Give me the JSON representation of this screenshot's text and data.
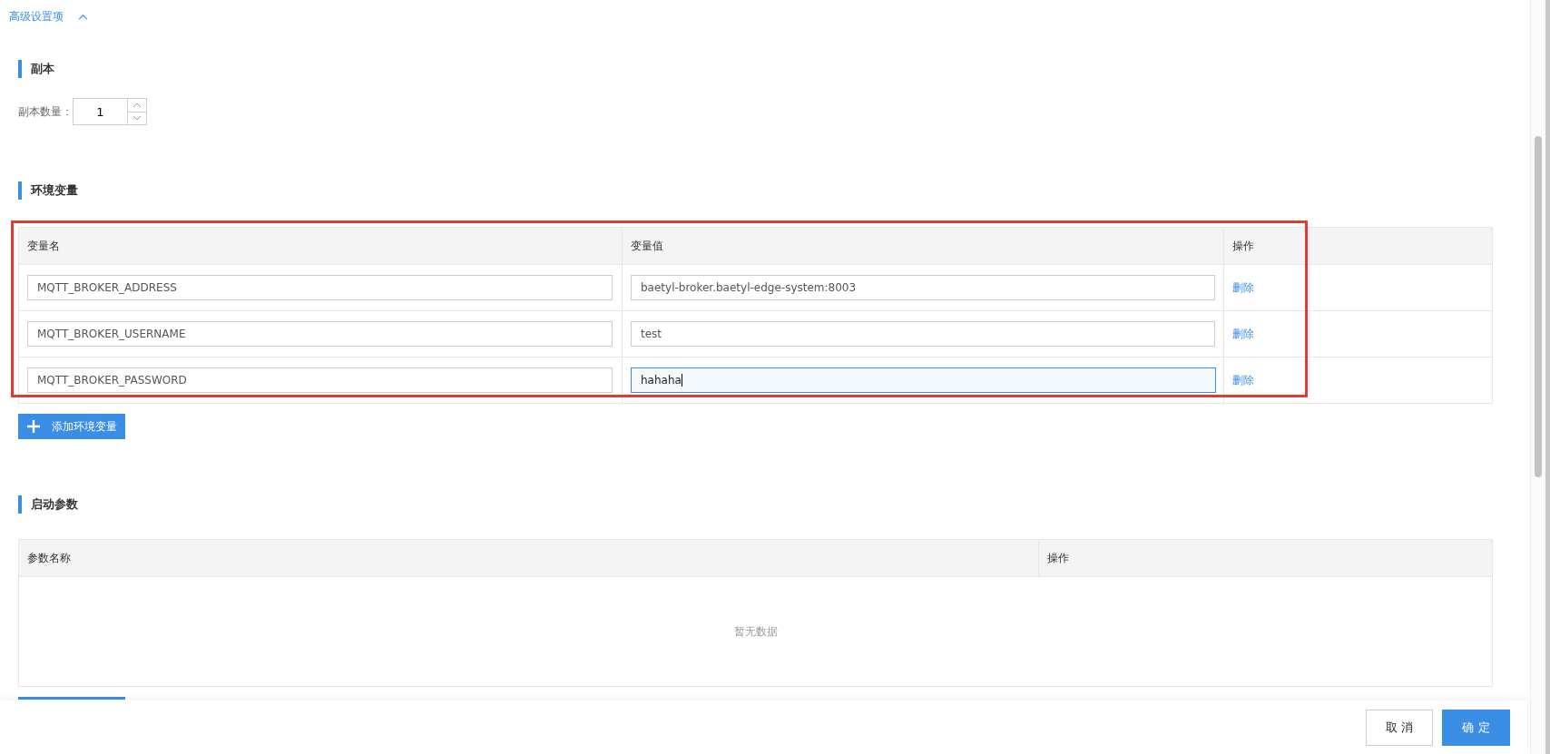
{
  "advanced": {
    "label": "高级设置项",
    "expanded": true
  },
  "replicas": {
    "title": "副本",
    "label": "副本数量：",
    "value": "1"
  },
  "env": {
    "title": "环境变量",
    "highlighted": true,
    "columns": [
      "变量名",
      "变量值",
      "操作"
    ],
    "rows": [
      {
        "name": "MQTT_BROKER_ADDRESS",
        "value": "baetyl-broker.baetyl-edge-system:8003",
        "action": "删除",
        "focused": false
      },
      {
        "name": "MQTT_BROKER_USERNAME",
        "value": "test",
        "action": "删除",
        "focused": false
      },
      {
        "name": "MQTT_BROKER_PASSWORD",
        "value": "hahaha",
        "action": "删除",
        "focused": true
      }
    ],
    "add_button": "添加环境变量"
  },
  "args": {
    "title": "启动参数",
    "columns": [
      "参数名称",
      "操作"
    ],
    "empty_text": "暂无数据"
  },
  "footer": {
    "buttons": [
      {
        "label": "取 消",
        "kind": "secondary"
      },
      {
        "label": "确 定",
        "kind": "primary"
      }
    ]
  }
}
